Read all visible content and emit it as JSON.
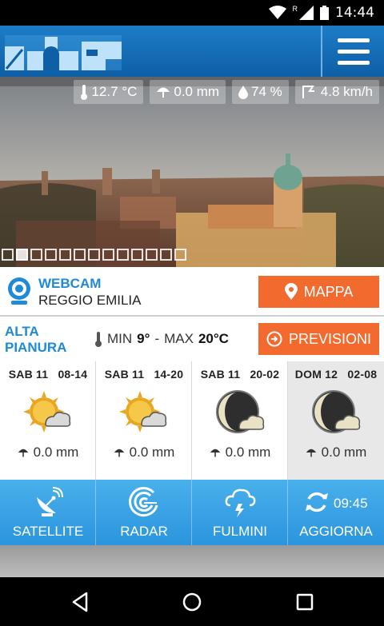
{
  "status_bar": {
    "time": "14:44",
    "icons": [
      "wifi-icon",
      "signal-roaming-icon",
      "battery-icon"
    ],
    "roaming_label": "R"
  },
  "header": {
    "logo": "skyline-logo",
    "menu_icon": "hamburger-menu-icon"
  },
  "webcam": {
    "readings": [
      {
        "icon": "thermometer-icon",
        "value": "12.7 °C"
      },
      {
        "icon": "umbrella-icon",
        "value": "0.0 mm"
      },
      {
        "icon": "humidity-drop-icon",
        "value": "74 %"
      },
      {
        "icon": "wind-icon",
        "value": "4.8 km/h"
      }
    ],
    "slide_count": 13,
    "active_slide": 1
  },
  "camera_info": {
    "title": "WEBCAM",
    "city": "REGGIO EMILIA",
    "map_button": "MAPPA"
  },
  "forecast": {
    "zone_line1": "ALTA",
    "zone_line2": "PIANURA",
    "min_label": "MIN",
    "min_value": "9°",
    "separator": "-",
    "max_label": "MAX",
    "max_value": "20°C",
    "forecast_button": "PREVISIONI",
    "columns": [
      {
        "label": "SAB 11   08-14",
        "icon": "sun-cloud-icon",
        "rain": "0.0 mm"
      },
      {
        "label": "SAB 11   14-20",
        "icon": "sun-cloud-icon",
        "rain": "0.0 mm"
      },
      {
        "label": "SAB 11   20-02",
        "icon": "moon-cloud-icon",
        "rain": "0.0 mm"
      },
      {
        "label": "DOM 12   02-08",
        "icon": "moon-cloud-icon",
        "rain": "0.0 mm"
      }
    ]
  },
  "toolbar": {
    "satellite": "SATELLITE",
    "radar": "RADAR",
    "lightning": "FULMINI",
    "refresh": "AGGIORNA",
    "refresh_time": "09:45"
  },
  "colors": {
    "brand_blue": "#1d7cc7",
    "accent_orange": "#f26a2e",
    "label_blue": "#1e8ad8",
    "toolbar_blue": "#3aa3e5"
  }
}
